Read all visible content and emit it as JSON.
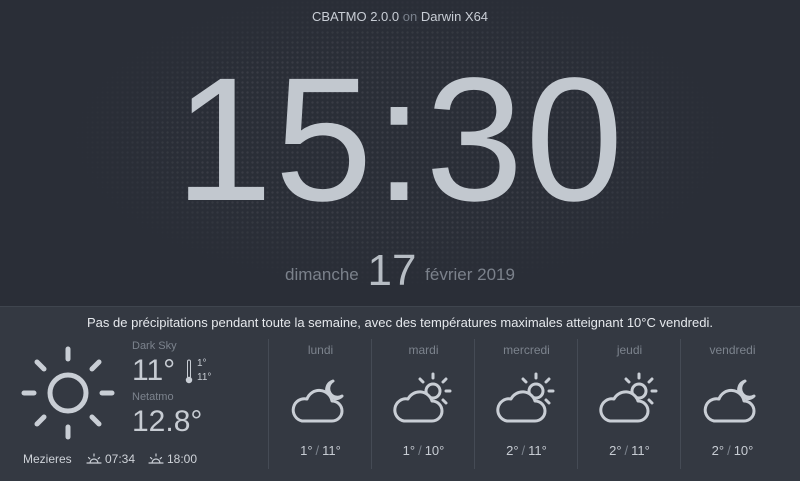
{
  "header": {
    "app": "CBATMO 2.0.0",
    "on": "on",
    "platform": "Darwin X64"
  },
  "clock": {
    "time": "15:30"
  },
  "date": {
    "weekday": "dimanche",
    "day": "17",
    "month_year": "février 2019"
  },
  "summary": "Pas de précipitations pendant toute la semaine, avec des températures maximales atteignant 10°C vendredi.",
  "current": {
    "icon": "sun-icon",
    "darksky": {
      "label": "Dark Sky",
      "temp": "11°",
      "min": "1°",
      "max": "11°"
    },
    "netatmo": {
      "label": "Netatmo",
      "temp": "12.8°"
    },
    "location": "Mezieres",
    "sunrise": "07:34",
    "sunset": "18:00"
  },
  "forecast": [
    {
      "day": "lundi",
      "icon": "cloud-moon-icon",
      "min": "1°",
      "max": "11°"
    },
    {
      "day": "mardi",
      "icon": "cloud-sun-icon",
      "min": "1°",
      "max": "10°"
    },
    {
      "day": "mercredi",
      "icon": "cloud-sun-icon",
      "min": "2°",
      "max": "11°"
    },
    {
      "day": "jeudi",
      "icon": "cloud-sun-icon",
      "min": "2°",
      "max": "11°"
    },
    {
      "day": "vendredi",
      "icon": "cloud-moon-icon",
      "min": "2°",
      "max": "10°"
    }
  ],
  "separator": "/",
  "colors": {
    "background": "#2a2e37",
    "panel": "#343942",
    "text": "#c7ccd3",
    "muted": "#7c838d"
  }
}
